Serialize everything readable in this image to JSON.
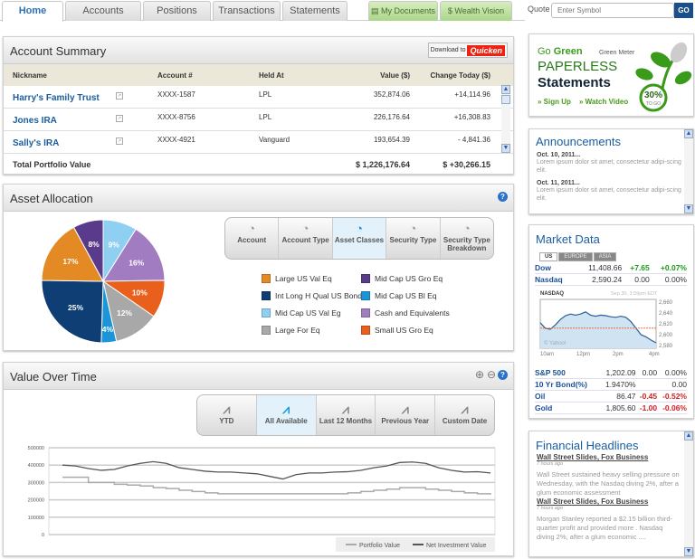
{
  "nav": {
    "tabs": [
      "Home",
      "Accounts",
      "Positions",
      "Transactions",
      "Statements"
    ],
    "active": "Home",
    "extra_tabs": [
      "My Documents",
      "Wealth Vision"
    ]
  },
  "quote": {
    "label": "Quote",
    "placeholder": "Enter Symbol",
    "go": "GO"
  },
  "account_summary": {
    "title": "Account Summary",
    "download_label": "Download to",
    "download_brand": "Quicken",
    "columns": [
      "Nickname",
      "Account #",
      "Held At",
      "Value ($)",
      "Change Today ($)"
    ],
    "rows": [
      {
        "nickname": "Harry's Family Trust",
        "account": "XXXX-1587",
        "held_at": "LPL",
        "value": "352,874.06",
        "change": "+14,114.96"
      },
      {
        "nickname": "Jones IRA",
        "account": "XXXX-8756",
        "held_at": "LPL",
        "value": "226,176.64",
        "change": "+16,308.83"
      },
      {
        "nickname": "Sally's IRA",
        "account": "XXXX-4921",
        "held_at": "Vanguard",
        "value": "193,654.39",
        "change": "- 4,841.36"
      }
    ],
    "total_label": "Total Portfolio Value",
    "total_value": "$ 1,226,176.64",
    "total_change": "$ +30,266.15"
  },
  "asset_allocation": {
    "title": "Asset Allocation",
    "views": [
      "Account",
      "Account Type",
      "Asset Classes",
      "Security Type",
      "Security Type Breakdown"
    ],
    "selected_view": "Asset Classes",
    "slices": [
      {
        "label": "Mid Cap US Val Eq",
        "pct": 9,
        "color": "#8fd0f2"
      },
      {
        "label": "Cash and Equivalents",
        "pct": 16,
        "color": "#a27cc0"
      },
      {
        "label": "Small US Gro Eq",
        "pct": 10,
        "color": "#e8601c"
      },
      {
        "label": "Large For Eq",
        "pct": 12,
        "color": "#a8a8a8"
      },
      {
        "label": "Mid Cap US Bl Eq",
        "pct": 4,
        "color": "#1c95d8"
      },
      {
        "label": "Int Long H Qual US Bond",
        "pct": 25,
        "color": "#0e3e74"
      },
      {
        "label": "Large US Val Eq",
        "pct": 17,
        "color": "#e38a24"
      },
      {
        "label": "Mid Cap US Gro Eq",
        "pct": 8,
        "color": "#5a3a8a"
      }
    ],
    "legend_order": [
      "Large US Val Eq",
      "Mid Cap US Gro Eq",
      "Int Long H Qual US Bond",
      "Mid Cap US Bl Eq",
      "Mid Cap US Val Eg",
      "Cash and Equivalents",
      "Large For Eq",
      "Small US Gro Eq"
    ]
  },
  "value_over_time": {
    "title": "Value Over Time",
    "ranges": [
      "YTD",
      "All Available",
      "Last 12 Months",
      "Previous Year",
      "Custom Date"
    ],
    "selected_range": "All Available",
    "chart_data": {
      "type": "line",
      "ylim": [
        0,
        500000
      ],
      "yticks": [
        "500000",
        "400000",
        "300000",
        "200000",
        "100000",
        "0"
      ],
      "series": [
        {
          "name": "Portfolio Value",
          "color": "#aaaaaa",
          "values": [
            330000,
            330000,
            300000,
            300000,
            290000,
            285000,
            280000,
            270000,
            265000,
            255000,
            248000,
            240000,
            235000,
            235000,
            235000,
            235000,
            235000,
            235000,
            235000,
            235000,
            235000,
            235000,
            240000,
            248000,
            255000,
            262000,
            270000,
            270000,
            262000,
            255000,
            248000,
            240000,
            235000,
            230000
          ]
        },
        {
          "name": "Net Investment Value",
          "color": "#555555",
          "values": [
            400000,
            395000,
            380000,
            370000,
            375000,
            395000,
            410000,
            420000,
            410000,
            385000,
            375000,
            365000,
            360000,
            360000,
            355000,
            350000,
            335000,
            320000,
            345000,
            355000,
            355000,
            360000,
            362000,
            370000,
            385000,
            395000,
            415000,
            418000,
            410000,
            385000,
            370000,
            360000,
            362000,
            355000
          ]
        }
      ],
      "legend": [
        "Portfolio Value",
        "Net Investment Value"
      ]
    }
  },
  "green_ad": {
    "go": "Go",
    "green": "Green",
    "meter_label": "Green Meter",
    "line1": "PAPERLESS",
    "line2": "Statements",
    "signup": "» Sign Up",
    "video": "» Watch Video",
    "meter_value": "30%",
    "meter_sub": "TO GO"
  },
  "announcements": {
    "title": "Announcements",
    "items": [
      {
        "date": "Oct. 10, 2011...",
        "text": "Lorem ipsum dolor sit amet, consectetur adipi-scing elit."
      },
      {
        "date": "Oct. 11, 2011...",
        "text": "Lorem ipsum dolor sit amet, consectetur adipi-scing elit."
      }
    ]
  },
  "market_data": {
    "title": "Market Data",
    "tabs": [
      "US",
      "EUROPE",
      "ASIA"
    ],
    "active_tab": "US",
    "top": [
      {
        "name": "Dow",
        "value": "11,408.66",
        "chg": "+7.65",
        "pct": "+0.07%",
        "dir": "up"
      },
      {
        "name": "Nasdaq",
        "value": "2,590.24",
        "chg": "0.00",
        "pct": "0.00%",
        "dir": "flat"
      }
    ],
    "chart": {
      "symbol": "NASDAQ",
      "timestamp": "Sep 30, 3:59pm EDT",
      "source": "© Yahoo!",
      "yticks": [
        "2,660",
        "2,640",
        "2,620",
        "2,600",
        "2,580"
      ],
      "xticks": [
        "10am",
        "12pm",
        "2pm",
        "4pm"
      ],
      "prev_close": 2612,
      "ylim": [
        2575,
        2665
      ],
      "values": [
        2622,
        2612,
        2610,
        2618,
        2628,
        2635,
        2638,
        2636,
        2638,
        2642,
        2636,
        2634,
        2636,
        2635,
        2633,
        2632,
        2634,
        2632,
        2624,
        2612,
        2600,
        2596,
        2590,
        2585
      ]
    },
    "bottom": [
      {
        "name": "S&P 500",
        "value": "1,202.09",
        "chg": "0.00",
        "pct": "0.00%",
        "dir": "flat"
      },
      {
        "name": "10 Yr Bond(%)",
        "value": "1.9470%",
        "chg": "",
        "pct": "0.00",
        "dir": "flat"
      },
      {
        "name": "Oil",
        "value": "86.47",
        "chg": "-0.45",
        "pct": "-0.52%",
        "dir": "dn"
      },
      {
        "name": "Gold",
        "value": "1,805.60",
        "chg": "-1.00",
        "pct": "-0.06%",
        "dir": "dn"
      }
    ]
  },
  "headlines": {
    "title": "Financial Headlines",
    "items": [
      {
        "headline": "Wall Street Slides, Fox Business",
        "age": "7 hours ago",
        "text": "Wall Street sustained heavy selling pressure on Wednesday, with the Nasdaq diving 2%, after a glum economic assessment"
      },
      {
        "headline": "Wall Street Slides, Fox Business",
        "age": "7 hours ago",
        "text": "Morgan Stanley reported a $2.15 billion third-quarter profit and provided more . Nasdaq diving 2%, after a glum economic ...."
      }
    ]
  }
}
